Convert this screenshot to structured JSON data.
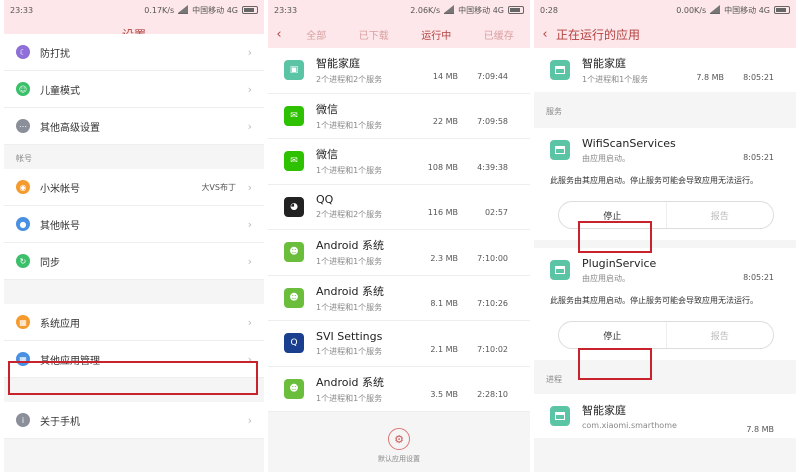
{
  "panel1": {
    "status": {
      "time": "23:33",
      "speed": "0.17K/s",
      "carrier": "中国移动 4G"
    },
    "title": "设置",
    "rows_top": [
      {
        "label": "防打扰",
        "icon": "moon-icon",
        "color": "#8e6fd8"
      },
      {
        "label": "儿童模式",
        "icon": "child-mode-icon",
        "color": "#3bbf6a"
      },
      {
        "label": "其他高级设置",
        "icon": "more-icon",
        "color": "#8a8f99"
      }
    ],
    "section_account": "帐号",
    "rows_account": [
      {
        "label": "小米帐号",
        "value": "大VS布丁",
        "icon": "mi-account-icon",
        "color": "#f59b2e"
      },
      {
        "label": "其他帐号",
        "icon": "user-icon",
        "color": "#4a90e2"
      },
      {
        "label": "同步",
        "icon": "sync-icon",
        "color": "#3bbf6a"
      }
    ],
    "rows_apps": [
      {
        "label": "系统应用",
        "icon": "system-apps-icon",
        "color": "#f59b2e"
      },
      {
        "label": "其他应用管理",
        "icon": "apps-icon",
        "color": "#4a90e2"
      }
    ],
    "about": {
      "label": "关于手机",
      "icon": "info-icon",
      "color": "#8a8f99"
    }
  },
  "panel2": {
    "status": {
      "time": "23:33",
      "speed": "2.06K/s",
      "carrier": "中国移动 4G"
    },
    "tabs": [
      "全部",
      "已下载",
      "运行中",
      "已缓存"
    ],
    "apps": [
      {
        "name": "智能家庭",
        "sub": "2个进程和2个服务",
        "size": "14 MB",
        "time": "7:09:44",
        "icon": "smart-home-icon",
        "color": "#5ac4a5"
      },
      {
        "name": "微信",
        "sub": "1个进程和1个服务",
        "size": "22 MB",
        "time": "7:09:58",
        "icon": "wechat-icon",
        "color": "#2dc100"
      },
      {
        "name": "微信",
        "sub": "1个进程和1个服务",
        "size": "108 MB",
        "time": "4:39:38",
        "icon": "wechat-icon",
        "color": "#2dc100"
      },
      {
        "name": "QQ",
        "sub": "2个进程和2个服务",
        "size": "116 MB",
        "time": "02:57",
        "icon": "qq-icon",
        "color": "#222222"
      },
      {
        "name": "Android 系统",
        "sub": "1个进程和1个服务",
        "size": "2.3 MB",
        "time": "7:10:00",
        "icon": "android-icon",
        "color": "#6bbd3c"
      },
      {
        "name": "Android 系统",
        "sub": "1个进程和1个服务",
        "size": "8.1 MB",
        "time": "7:10:26",
        "icon": "android-icon",
        "color": "#6bbd3c"
      },
      {
        "name": "SVI Settings",
        "sub": "1个进程和1个服务",
        "size": "2.1 MB",
        "time": "7:10:02",
        "icon": "svi-settings-icon",
        "color": "#1a3f8f"
      },
      {
        "name": "Android 系统",
        "sub": "1个进程和1个服务",
        "size": "3.5 MB",
        "time": "2:28:10",
        "icon": "android-icon",
        "color": "#6bbd3c"
      }
    ],
    "footer_label": "默认应用设置"
  },
  "panel3": {
    "status": {
      "time": "0:28",
      "speed": "0.00K/s",
      "carrier": "中国移动 4G"
    },
    "title": "正在运行的应用",
    "top_app": {
      "name": "智能家庭",
      "sub": "1个进程和1个服务",
      "size": "7.8 MB",
      "time": "8:05:21"
    },
    "services_label": "服务",
    "services": [
      {
        "name": "WifiScanServices",
        "sub": "由应用启动。",
        "time": "8:05:21"
      },
      {
        "name": "PluginService",
        "sub": "由应用启动。",
        "time": "8:05:21"
      }
    ],
    "desc": "此服务由其应用启动。停止服务可能会导致应用无法运行。",
    "stop_label": "停止",
    "report_label": "报告",
    "process_label": "进程",
    "bottom_app": {
      "name": "智能家庭",
      "sub": "com.xiaomi.smarthome",
      "size": "7.8 MB"
    }
  }
}
